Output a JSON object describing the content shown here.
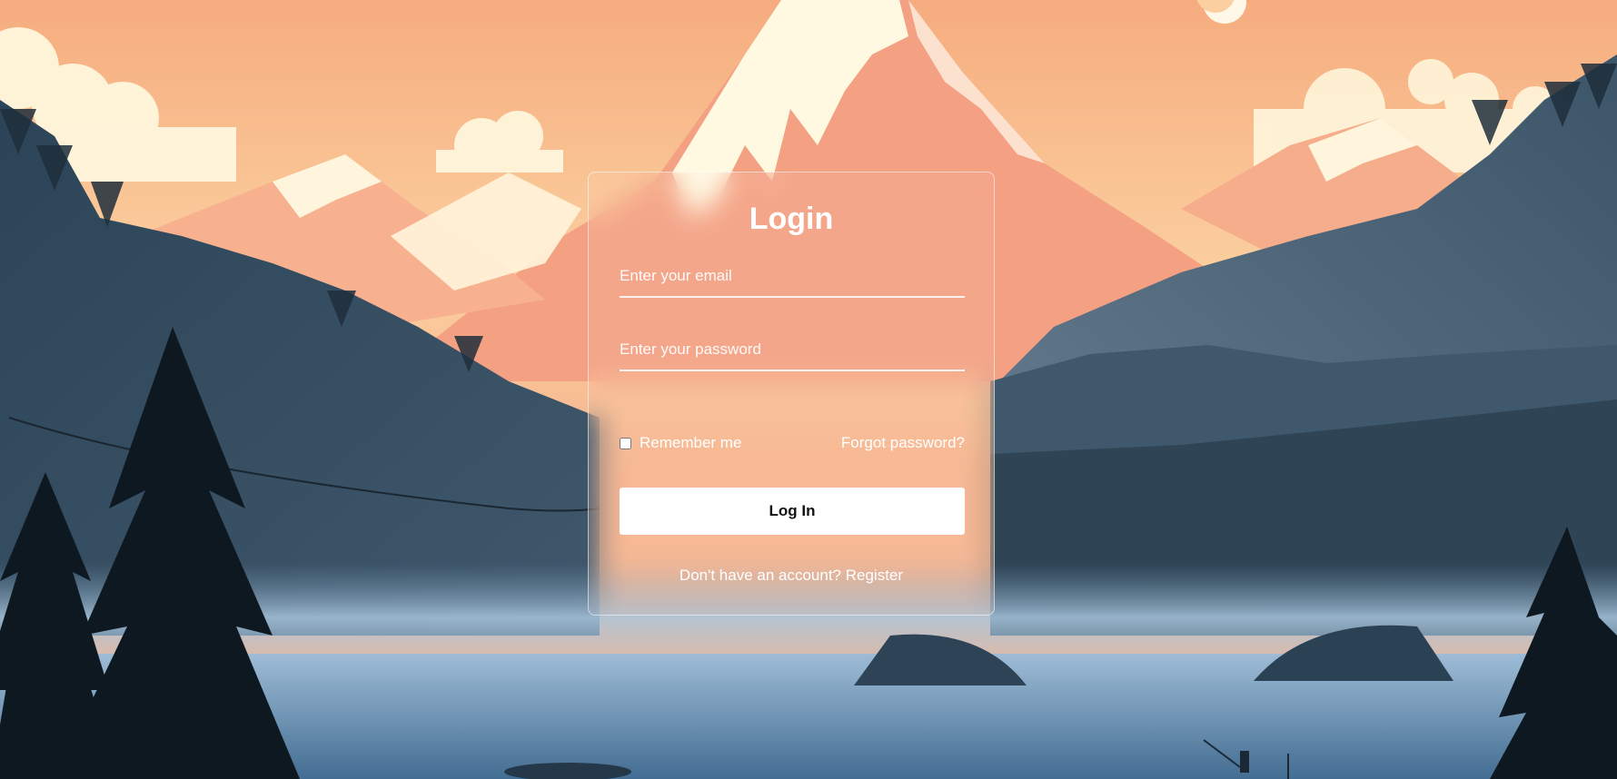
{
  "login": {
    "title": "Login",
    "email_placeholder": "Enter your email",
    "password_placeholder": "Enter your password",
    "remember_label": "Remember me",
    "forgot_link": "Forgot password?",
    "submit_label": "Log In",
    "register_prompt": "Don't have an account?",
    "register_link": "Register"
  },
  "colors": {
    "sky_top": "#f7b98a",
    "sky_glow": "#fde9c2",
    "mountain_snow": "#fff7e0",
    "mountain_peach": "#f3a384",
    "forest_dark": "#2a3b4a",
    "lake": "#8fb2cf",
    "button_bg": "#ffffff",
    "button_text": "#111111"
  },
  "icons": [
    "moon-icon",
    "checkbox-icon"
  ]
}
